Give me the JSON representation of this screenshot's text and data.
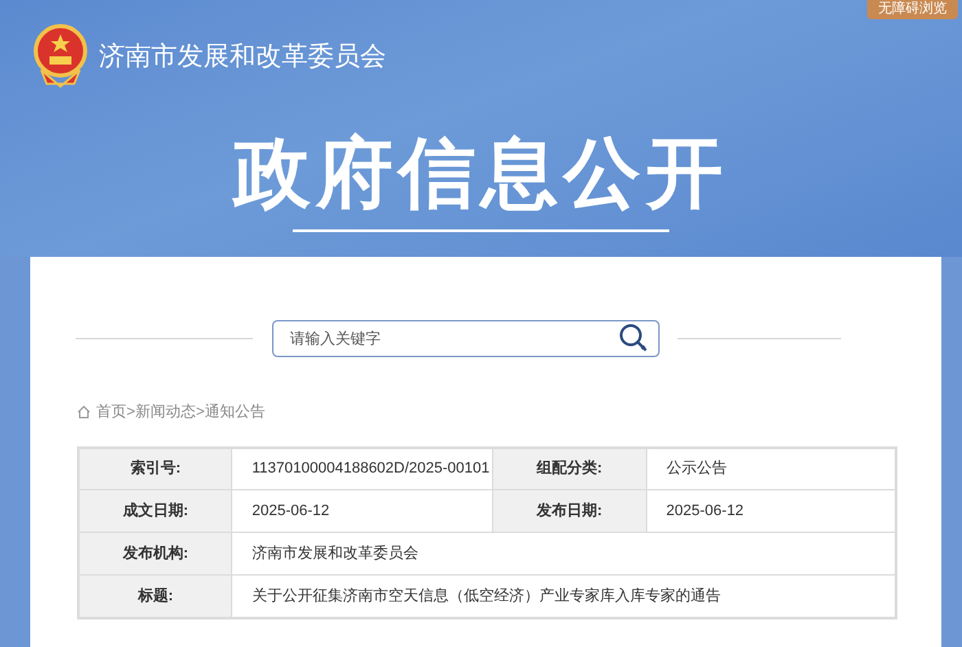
{
  "header": {
    "accessibility_link": "无障碍浏览",
    "org_name": "济南市发展和改革委员会",
    "title": "政府信息公开"
  },
  "search": {
    "placeholder": "请输入关键字"
  },
  "breadcrumb": {
    "separator": ">",
    "items": [
      "首页",
      "新闻动态",
      "通知公告"
    ]
  },
  "metadata": [
    {
      "cells": [
        {
          "label": "索引号:",
          "value": "11370100004188602D/2025-00101"
        },
        {
          "label": "组配分类:",
          "value": "公示公告"
        }
      ]
    },
    {
      "cells": [
        {
          "label": "成文日期:",
          "value": "2025-06-12"
        },
        {
          "label": "发布日期:",
          "value": "2025-06-12"
        }
      ]
    },
    {
      "cells": [
        {
          "label": "发布机构:",
          "value": "济南市发展和改革委员会"
        }
      ]
    },
    {
      "cells": [
        {
          "label": "标题:",
          "value": "关于公开征集济南市空天信息（低空经济）产业专家库入库专家的通告"
        }
      ]
    }
  ]
}
